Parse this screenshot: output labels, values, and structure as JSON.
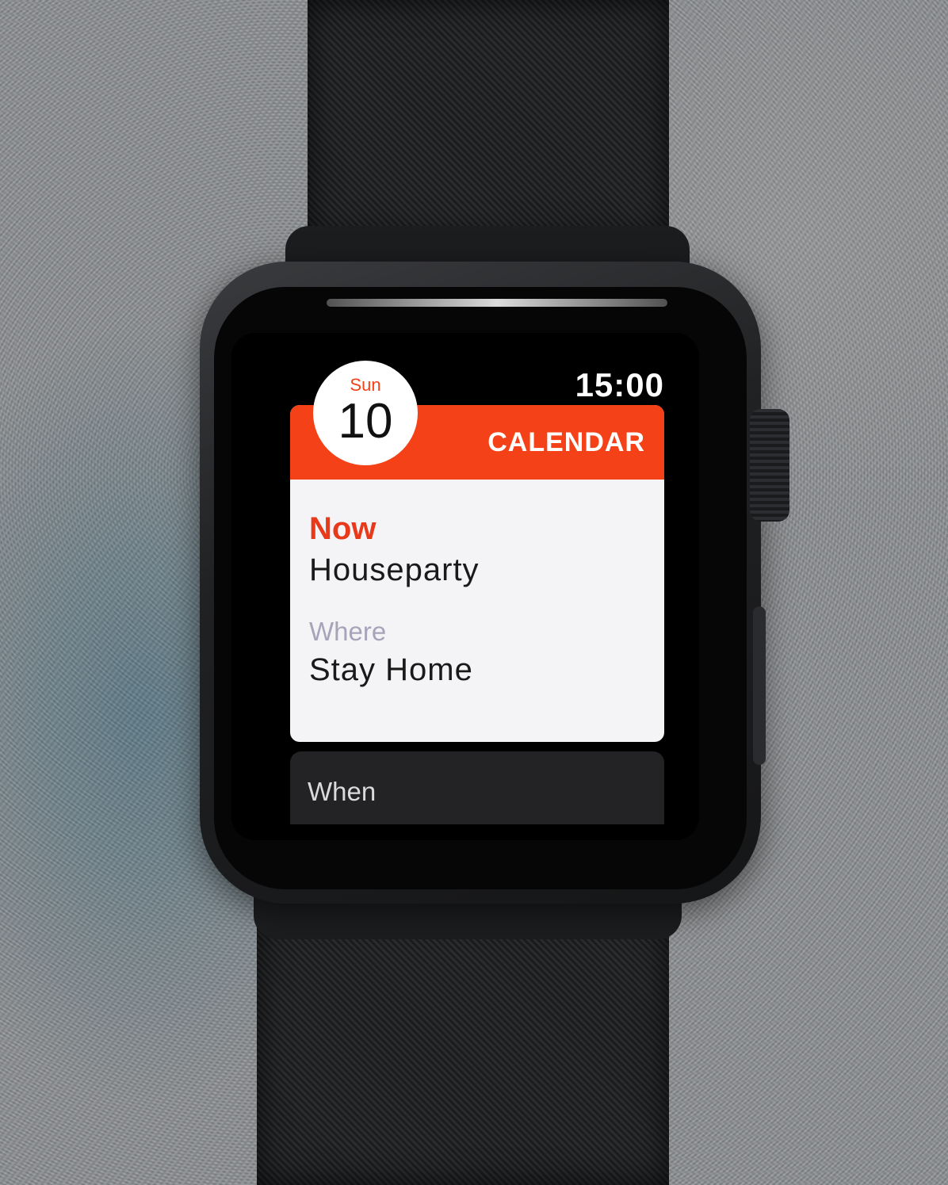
{
  "status_bar": {
    "time": "15:00"
  },
  "date_badge": {
    "weekday": "Sun",
    "day": "10"
  },
  "event_card": {
    "app_name": "CALENDAR",
    "status_label": "Now",
    "title": "Houseparty",
    "where_label": "Where",
    "where_value": "Stay Home"
  },
  "next_card": {
    "when_label": "When"
  },
  "colors": {
    "accent": "#f54117",
    "card_background": "#f4f4f6",
    "secondary_label": "#a7a4b9"
  }
}
